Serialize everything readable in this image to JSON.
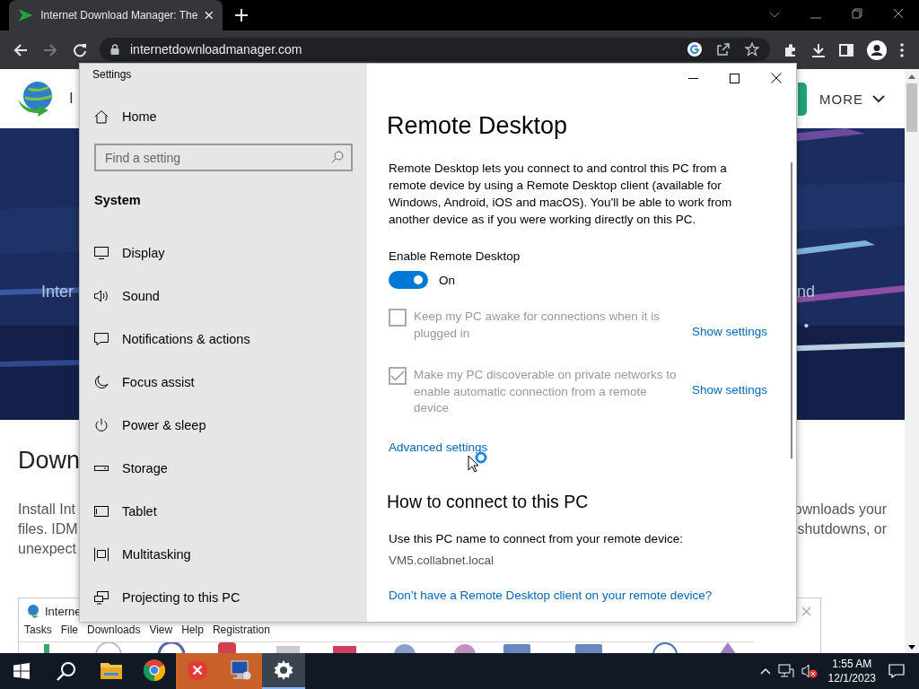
{
  "browser": {
    "tab": {
      "title": "Internet Download Manager: The"
    },
    "navigation": [
      {
        "kind": "back",
        "disabled": false
      },
      {
        "kind": "forward",
        "disabled": true
      },
      {
        "kind": "reload",
        "disabled": false
      }
    ],
    "address": "internetdownloadmanager.com"
  },
  "site": {
    "logo_text": "I",
    "menu": "MORE",
    "banner_left": "Inter",
    "banner_right": "nd",
    "heading": "Down",
    "text_left": [
      "Install Int",
      "files. IDM",
      "unexpect"
    ],
    "text_right": [
      "ownloads your",
      "shutdowns, or"
    ]
  },
  "idm_window": {
    "title": "Interne",
    "menu": [
      "Tasks",
      "File",
      "Downloads",
      "View",
      "Help",
      "Registration"
    ]
  },
  "settings": {
    "title": "Settings",
    "home": "Home",
    "search": {
      "placeholder": "Find a setting"
    },
    "section": "System",
    "nav": [
      "Display",
      "Sound",
      "Notifications & actions",
      "Focus assist",
      "Power & sleep",
      "Storage",
      "Tablet",
      "Multitasking",
      "Projecting to this PC"
    ],
    "page": {
      "title": "Remote Desktop",
      "intro": "Remote Desktop lets you connect to and control this PC from a remote device by using a Remote Desktop client (available for Windows, Android, iOS and macOS). You'll be able to work from another device as if you were working directly on this PC.",
      "enable": {
        "label": "Enable Remote Desktop",
        "on": true,
        "state_text": "On"
      },
      "options": [
        {
          "label": "Keep my PC awake for connections when it is plugged in",
          "checked": false,
          "disabled": true,
          "link": "Show settings"
        },
        {
          "label": "Make my PC discoverable on private networks to enable automatic connection from a remote device",
          "checked": true,
          "disabled": true,
          "link": "Show settings"
        }
      ],
      "advanced": "Advanced settings",
      "connect_heading": "How to connect to this PC",
      "pc_name_label": "Use this PC name to connect from your remote device:",
      "pc_name": "VM5.collabnet.local",
      "client_link": "Don’t have a Remote Desktop client on your remote device?"
    }
  },
  "taskbar": {
    "apps": [
      {
        "kind": "explorer",
        "flashing": false,
        "active": false
      },
      {
        "kind": "chrome",
        "flashing": false,
        "active": false
      },
      {
        "kind": "error",
        "flashing": true,
        "active": false
      },
      {
        "kind": "remote",
        "flashing": true,
        "active": false
      },
      {
        "kind": "settings",
        "flashing": false,
        "active": true
      }
    ],
    "time": "1:55 AM",
    "date": "12/1/2023"
  }
}
